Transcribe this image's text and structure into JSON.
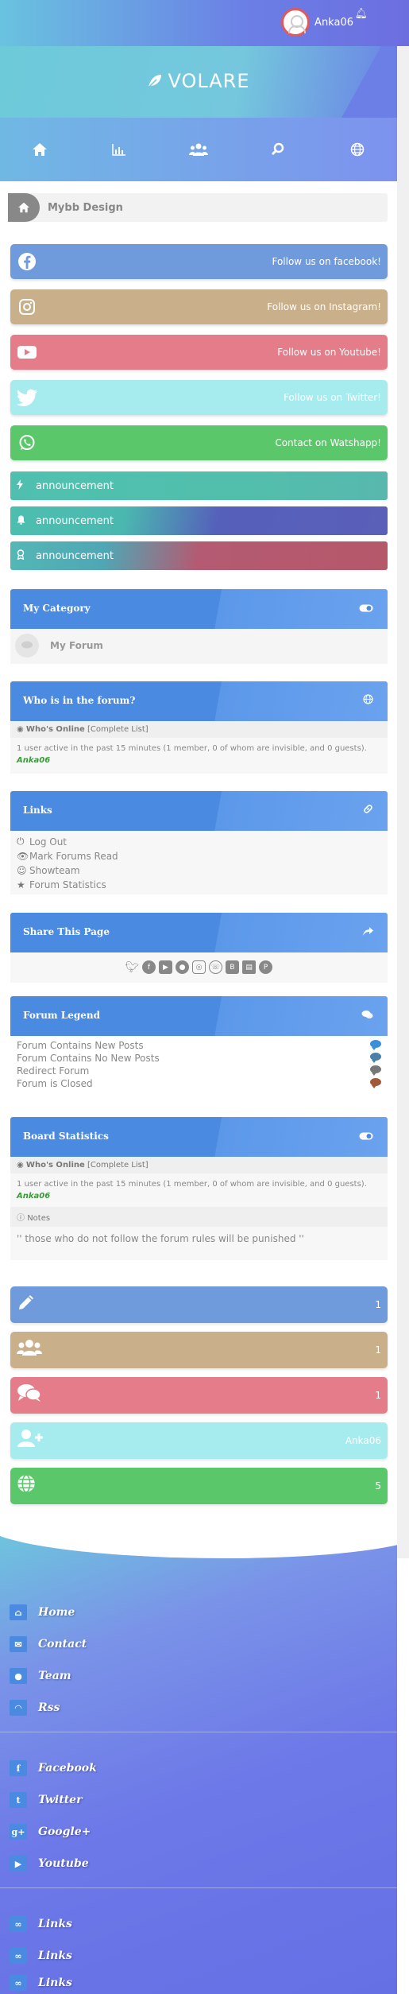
{
  "header": {
    "username": "Anka06",
    "logo_text": "VOLARE"
  },
  "nav": [
    "home-icon",
    "stats-icon",
    "members-icon",
    "search-icon",
    "globe-icon"
  ],
  "breadcrumb": {
    "label": "Mybb Design"
  },
  "social": [
    {
      "label": "Follow us on facebook!",
      "icon": "facebook-icon",
      "color": "#6f9bdc",
      "glyph": "f"
    },
    {
      "label": "Follow us on Instagram!",
      "icon": "instagram-icon",
      "color": "#c9b08a",
      "glyph": "◎"
    },
    {
      "label": "Follow us on Youtube!",
      "icon": "youtube-icon",
      "color": "#e57c8a",
      "glyph": "▶"
    },
    {
      "label": "Follow us on Twitter!",
      "icon": "twitter-icon",
      "color": "#a6ecee",
      "glyph": "🐦"
    },
    {
      "label": "Contact on Watshapp!",
      "icon": "whatsapp-icon",
      "color": "#5ac86a",
      "glyph": "☏"
    }
  ],
  "announcements": [
    {
      "label": "announcement",
      "icon": "bolt-icon"
    },
    {
      "label": "announcement",
      "icon": "bell-icon"
    },
    {
      "label": "announcement",
      "icon": "award-icon"
    }
  ],
  "category": {
    "title": "My Category",
    "forum": "My Forum"
  },
  "online": {
    "title": "Who is in the forum?",
    "whos_online": "Who's Online",
    "complete_list": "[Complete List]",
    "summary": "1 user active in the past 15 minutes (1 member, 0 of whom are invisible, and 0 guests).",
    "user": "Anka06"
  },
  "links": {
    "title": "Links",
    "items": [
      "Log Out",
      "Mark Forums Read",
      "Showteam",
      "Forum Statistics"
    ]
  },
  "share": {
    "title": "Share This Page"
  },
  "legend": {
    "title": "Forum Legend",
    "items": [
      {
        "label": "Forum Contains New Posts",
        "color": "#3a8fd8"
      },
      {
        "label": "Forum Contains No New Posts",
        "color": "#4a7fa8"
      },
      {
        "label": "Redirect Forum",
        "color": "#777777"
      },
      {
        "label": "Forum is Closed",
        "color": "#a05a3a"
      }
    ]
  },
  "board_stats": {
    "title": "Board Statistics",
    "whos_online": "Who's Online",
    "complete_list": "[Complete List]",
    "summary": "1 user active in the past 15 minutes (1 member, 0 of whom are invisible, and 0 guests).",
    "user": "Anka06",
    "notes_label": "Notes",
    "notes_text": "'' those who do not follow the forum rules will be punished ''"
  },
  "stats": [
    {
      "icon": "pencil-icon",
      "value": "1",
      "color": "#6f9bdc"
    },
    {
      "icon": "users-icon",
      "value": "1",
      "color": "#c9b08a"
    },
    {
      "icon": "comments-icon",
      "value": "1",
      "color": "#e57c8a"
    },
    {
      "icon": "user-plus-icon",
      "value": "Anka06",
      "color": "#a6ecee"
    },
    {
      "icon": "globe-icon",
      "value": "5",
      "color": "#5ac86a"
    }
  ],
  "footer": {
    "group1": [
      "Home",
      "Contact",
      "Team",
      "Rss"
    ],
    "group2": [
      "Facebook",
      "Twitter",
      "Google+",
      "Youtube"
    ],
    "group3": [
      "Links",
      "Links",
      "Links"
    ]
  }
}
